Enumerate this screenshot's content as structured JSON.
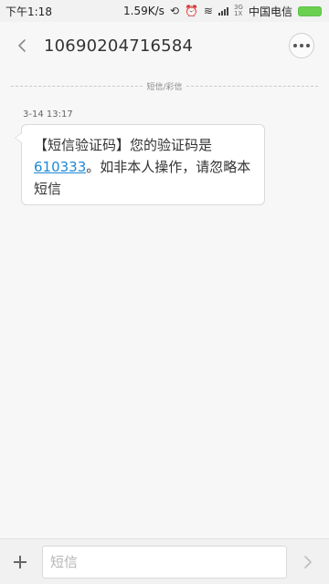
{
  "status_bar": {
    "time": "下午1:18",
    "speed": "1.59K/s",
    "network_type": "3G 1X",
    "carrier": "中国电信",
    "icons": [
      "alarm-icon",
      "sync-off-icon",
      "wifi-icon",
      "signal-icon",
      "battery-icon"
    ],
    "battery_color": "#6bd04f"
  },
  "header": {
    "title": "10690204716584",
    "back_icon": "chevron-left-icon",
    "more_icon": "more-horizontal-icon"
  },
  "divider": {
    "label": "短信/彩信"
  },
  "message": {
    "timestamp": "3-14 13:17",
    "text_before": "【短信验证码】您的验证码是",
    "code": "610333",
    "text_after": "。如非本人操作，请忽略本短信",
    "link_color": "#1e88d6"
  },
  "input_bar": {
    "placeholder": "短信",
    "value": "",
    "add_icon": "plus-icon",
    "send_icon": "chevron-right-icon"
  }
}
